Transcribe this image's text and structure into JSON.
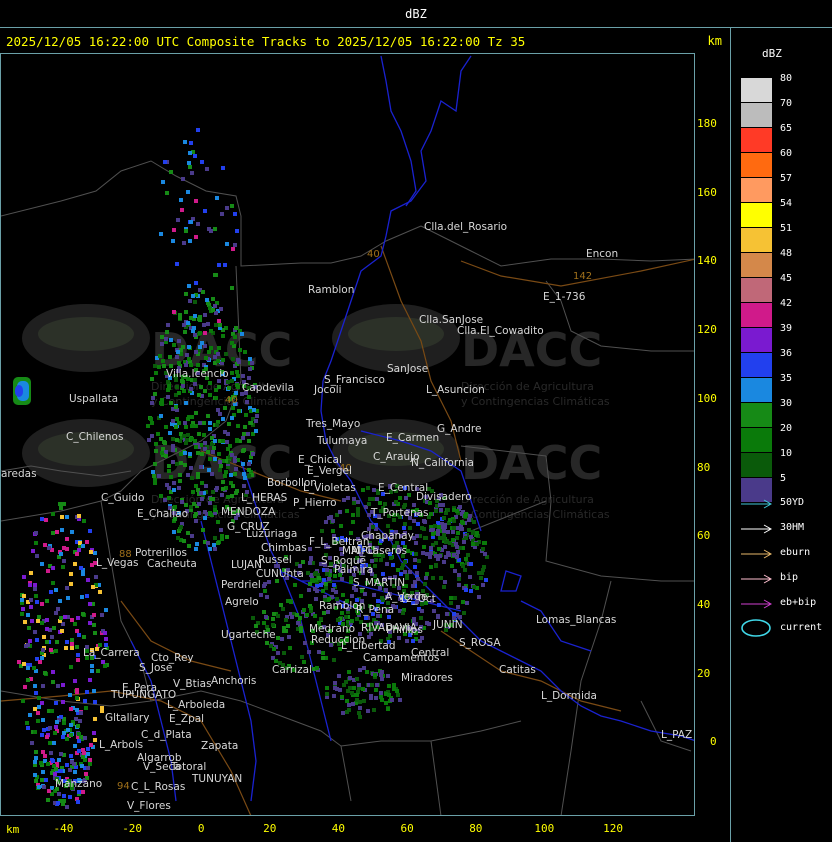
{
  "window": {
    "title": "dBZ"
  },
  "header": {
    "title": "2025/12/05 16:22:00 UTC Composite Tracks to 2025/12/05 16:22:00 Tz 35",
    "unit": "km"
  },
  "legend": {
    "title": "dBZ",
    "levels": [
      {
        "label": "80",
        "color": "#d8d8d8"
      },
      {
        "label": "70",
        "color": "#bcbcbc"
      },
      {
        "label": "65",
        "color": "#ff3a26"
      },
      {
        "label": "60",
        "color": "#ff6a10"
      },
      {
        "label": "57",
        "color": "#ff9a60"
      },
      {
        "label": "54",
        "color": "#ffff00"
      },
      {
        "label": "51",
        "color": "#f6c234"
      },
      {
        "label": "48",
        "color": "#d4884a"
      },
      {
        "label": "45",
        "color": "#c06878"
      },
      {
        "label": "42",
        "color": "#d01a8a"
      },
      {
        "label": "39",
        "color": "#7a1ad0"
      },
      {
        "label": "36",
        "color": "#2240ee"
      },
      {
        "label": "35",
        "color": "#1a88e0"
      },
      {
        "label": "30",
        "color": "#168a16"
      },
      {
        "label": "20",
        "color": "#0a7a0a"
      },
      {
        "label": "10",
        "color": "#0a5a0a"
      },
      {
        "label": "5",
        "color": "#4a3a8a"
      }
    ],
    "tracks": [
      {
        "label": "50YD",
        "color": "#40c8d8"
      },
      {
        "label": "30HM",
        "color": "#ffffff"
      },
      {
        "label": "eburn",
        "color": "#e8b86a"
      },
      {
        "label": "bip",
        "color": "#ffc0d0"
      },
      {
        "label": "eb+bip",
        "color": "#d040d0"
      }
    ],
    "current": {
      "label": "current",
      "color": "#40d8e8"
    }
  },
  "axes": {
    "x_unit": "km",
    "x_ticks": [
      "-40",
      "-20",
      "0",
      "20",
      "40",
      "60",
      "80",
      "100",
      "120"
    ],
    "y_ticks": [
      "180",
      "160",
      "140",
      "120",
      "100",
      "80",
      "60",
      "40",
      "20",
      "0"
    ]
  },
  "watermark": {
    "brand": "DACC",
    "line1": "Dirección de Agricultura",
    "line2": "y Contingencias Climáticas"
  },
  "map": {
    "route_labels": [
      "40",
      "142",
      "40",
      "88",
      "40",
      "94"
    ],
    "places": [
      {
        "name": "Clla.del_Rosario"
      },
      {
        "name": "Encon"
      },
      {
        "name": "E_1-736"
      },
      {
        "name": "Ramblon"
      },
      {
        "name": "Clla.SanJose"
      },
      {
        "name": "Clla.El_Cowadito"
      },
      {
        "name": "Villa.Icencio"
      },
      {
        "name": "S_Francisco"
      },
      {
        "name": "SanJose"
      },
      {
        "name": "Uspallata"
      },
      {
        "name": "Capdevila"
      },
      {
        "name": "Jocoli"
      },
      {
        "name": "L_Asuncion"
      },
      {
        "name": "Tres_Mayo"
      },
      {
        "name": "G_Andre"
      },
      {
        "name": "C_Chilenos"
      },
      {
        "name": "Tulumaya"
      },
      {
        "name": "E_Carmen"
      },
      {
        "name": "E_Chical"
      },
      {
        "name": "C_Araujo"
      },
      {
        "name": "N_California"
      },
      {
        "name": "aredas"
      },
      {
        "name": "E_Vergel"
      },
      {
        "name": "Borbollon"
      },
      {
        "name": "L_Violetas"
      },
      {
        "name": "E_Central"
      },
      {
        "name": "Divisadero"
      },
      {
        "name": "C_Guido"
      },
      {
        "name": "L_HERAS"
      },
      {
        "name": "P_Hierro"
      },
      {
        "name": "E_Challao"
      },
      {
        "name": "MENDOZA"
      },
      {
        "name": "T_Portenas"
      },
      {
        "name": "G_CRUZ"
      },
      {
        "name": "Luzuriaga"
      },
      {
        "name": "F_L_Beltran"
      },
      {
        "name": "Chapanay"
      },
      {
        "name": "MAIPU"
      },
      {
        "name": "Chimbas"
      },
      {
        "name": "M_Caseros"
      },
      {
        "name": "Potrerillos"
      },
      {
        "name": "Russel"
      },
      {
        "name": "S_Roque"
      },
      {
        "name": "L_Vegas"
      },
      {
        "name": "Cacheuta"
      },
      {
        "name": "LUJAN"
      },
      {
        "name": "Palmira"
      },
      {
        "name": "CUNUnta"
      },
      {
        "name": "S_MARTIN"
      },
      {
        "name": "Perdriel"
      },
      {
        "name": "A_Verde"
      },
      {
        "name": "Agrelo"
      },
      {
        "name": "Ramblon"
      },
      {
        "name": "R_Pena"
      },
      {
        "name": "JUNIN"
      },
      {
        "name": "Lomas_Blancas"
      },
      {
        "name": "12_Oct"
      },
      {
        "name": "Ugarteche"
      },
      {
        "name": "Medrano"
      },
      {
        "name": "RIVADAVIA"
      },
      {
        "name": "Phillips"
      },
      {
        "name": "S_ROSA"
      },
      {
        "name": "Reduccion"
      },
      {
        "name": "L_Libertad"
      },
      {
        "name": "Central"
      },
      {
        "name": "La_Carrera"
      },
      {
        "name": "Cto_Rey"
      },
      {
        "name": "Campamentos"
      },
      {
        "name": "S_Jose"
      },
      {
        "name": "Carrizal"
      },
      {
        "name": "Catitas"
      },
      {
        "name": "Miradores"
      },
      {
        "name": "E_Pera"
      },
      {
        "name": "V_Btias"
      },
      {
        "name": "Anchoris"
      },
      {
        "name": "TUPUNGATO"
      },
      {
        "name": "L_Dormida"
      },
      {
        "name": "L_Arboleda"
      },
      {
        "name": "Gltallary"
      },
      {
        "name": "E_Zpal"
      },
      {
        "name": "C_d_Plata"
      },
      {
        "name": "L_Arbols"
      },
      {
        "name": "Zapata"
      },
      {
        "name": "L_PAZ"
      },
      {
        "name": "V_Seca"
      },
      {
        "name": "Algarrob"
      },
      {
        "name": "Totoral"
      },
      {
        "name": "TUNUYAN"
      },
      {
        "name": "Manzano"
      },
      {
        "name": "C_L_Rosas"
      },
      {
        "name": "V_Flores"
      }
    ]
  }
}
